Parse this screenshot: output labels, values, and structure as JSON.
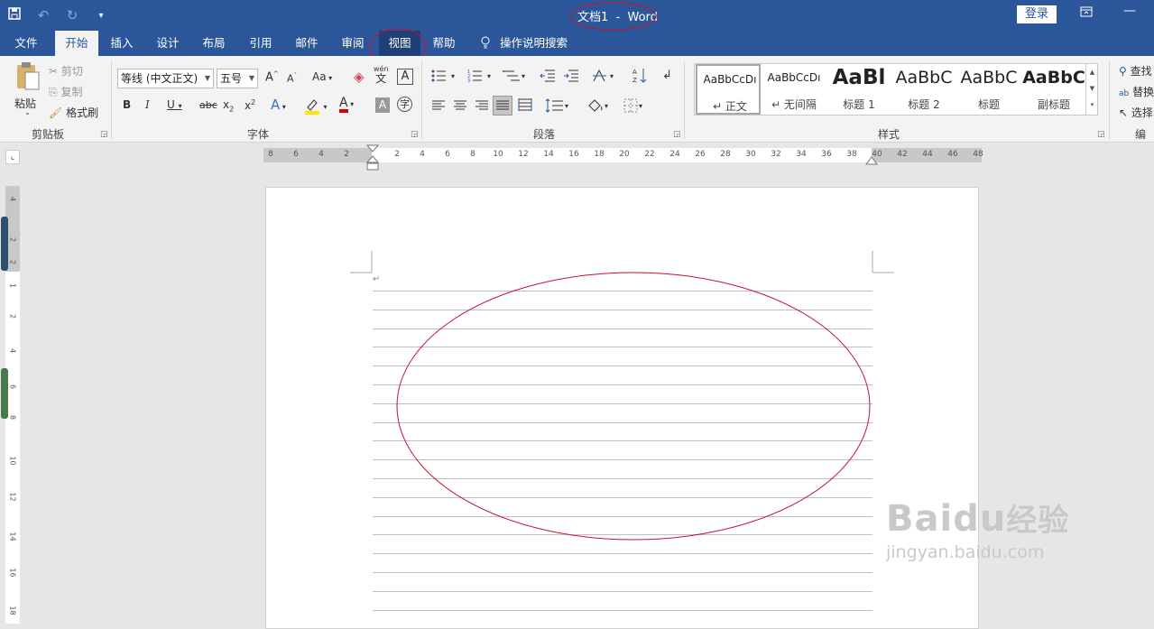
{
  "window": {
    "title": "文档1  -  Word",
    "login_label": "登录"
  },
  "qat": {
    "icons": [
      "save-icon",
      "undo-icon",
      "redo-icon",
      "customize-icon"
    ]
  },
  "tabs": [
    "文件",
    "开始",
    "插入",
    "设计",
    "布局",
    "引用",
    "邮件",
    "审阅",
    "视图",
    "帮助",
    "操作说明搜索"
  ],
  "ribbon": {
    "clipboard": {
      "paste": "粘贴",
      "cut": "剪切",
      "copy": "复制",
      "format_painter": "格式刷",
      "label": "剪贴板"
    },
    "font": {
      "font_name": "等线 (中文正文)",
      "font_size": "五号",
      "label": "字体",
      "case": "Aa",
      "wen": "wén",
      "wen_char": "文"
    },
    "paragraph": {
      "label": "段落"
    },
    "styles": {
      "items": [
        {
          "preview": "AaBbCcDı",
          "name": "↵ 正文"
        },
        {
          "preview": "AaBbCcDı",
          "name": "↵ 无间隔"
        },
        {
          "preview": "AaBl",
          "name": "标题 1"
        },
        {
          "preview": "AaBbC",
          "name": "标题 2"
        },
        {
          "preview": "AaBbC",
          "name": "标题"
        },
        {
          "preview": "AaBbC",
          "name": "副标题"
        }
      ],
      "label": "样式"
    },
    "editing": {
      "find": "查找",
      "replace": "替换",
      "select": "选择",
      "label": "编辑"
    }
  },
  "ruler": {
    "ticks": [
      "8",
      "6",
      "4",
      "2",
      "2",
      "4",
      "6",
      "8",
      "10",
      "12",
      "14",
      "16",
      "18",
      "20",
      "22",
      "24",
      "26",
      "28",
      "30",
      "32",
      "34",
      "36",
      "38",
      "40",
      "42",
      "44",
      "46",
      "48"
    ]
  },
  "vruler": {
    "ticks": [
      "4",
      "2",
      "2",
      "1",
      "2",
      "4",
      "6",
      "8",
      "10",
      "12",
      "14",
      "16",
      "18"
    ]
  },
  "watermark": {
    "brand": "Baidu",
    "cn": "经验",
    "url": "jingyan.baidu.com"
  }
}
